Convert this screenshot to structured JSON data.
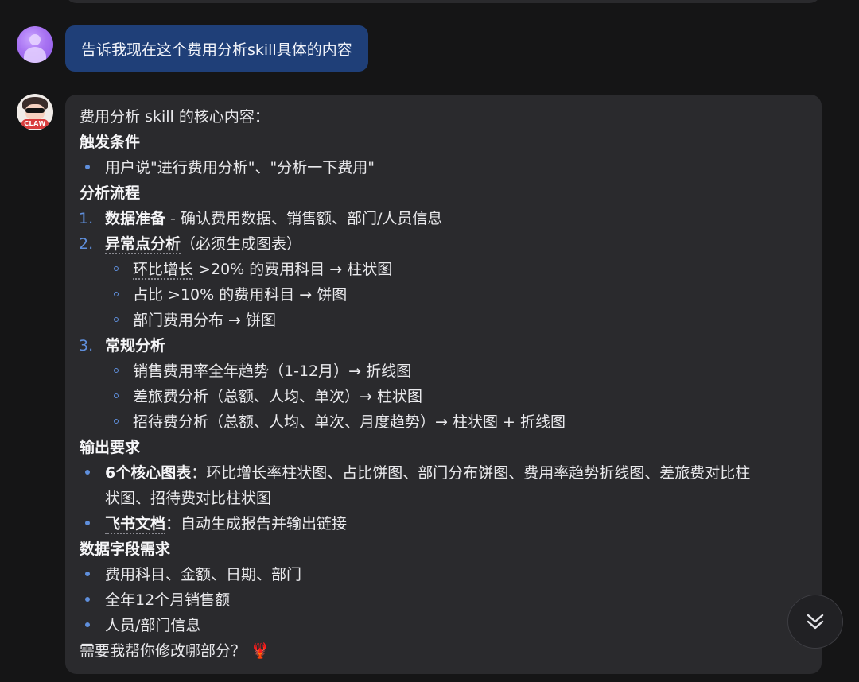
{
  "user_message": "告诉我现在这个费用分析skill具体的内容",
  "bot_avatar_badge": "CLAW",
  "reply": {
    "intro": "费用分析 skill 的核心内容：",
    "sec1_title": "触发条件",
    "sec1_item1": "用户说\"进行费用分析\"、\"分析一下费用\"",
    "sec2_title": "分析流程",
    "step1_num": "1.",
    "step1_bold": "数据准备",
    "step1_rest": " - 确认费用数据、销售额、部门/人员信息",
    "step2_num": "2.",
    "step2_bold": "异常点分析",
    "step2_rest": "（必须生成图表）",
    "step2_sub1_a": "环比增长",
    "step2_sub1_b": " >20% 的费用科目 → 柱状图",
    "step2_sub2": "占比 >10% 的费用科目 → 饼图",
    "step2_sub3": "部门费用分布 → 饼图",
    "step3_num": "3.",
    "step3_bold": "常规分析",
    "step3_sub1": "销售费用率全年趋势（1-12月）→ 折线图",
    "step3_sub2": "差旅费分析（总额、人均、单次）→ 柱状图",
    "step3_sub3": "招待费分析（总额、人均、单次、月度趋势）→ 柱状图 + 折线图",
    "sec3_title": "输出要求",
    "out1_bold": "6个核心图表",
    "out1_rest_line1": "：环比增长率柱状图、占比饼图、部门分布饼图、费用率趋势折线图、差旅费对比柱",
    "out1_rest_line2": "状图、招待费对比柱状图",
    "out2_bold": "飞书文档",
    "out2_rest": "：自动生成报告并输出链接",
    "sec4_title": "数据字段需求",
    "field1": "费用科目、金额、日期、部门",
    "field2": "全年12个月销售额",
    "field3": "人员/部门信息",
    "closing": "需要我帮你修改哪部分？",
    "closing_emoji": "🦞"
  },
  "icons": {
    "scroll_down": "chevron-double-down-icon"
  },
  "colors": {
    "user_bubble": "#1f3f78",
    "bot_bubble": "#2a2a2d",
    "accent_bullet": "#5f8fdc"
  }
}
